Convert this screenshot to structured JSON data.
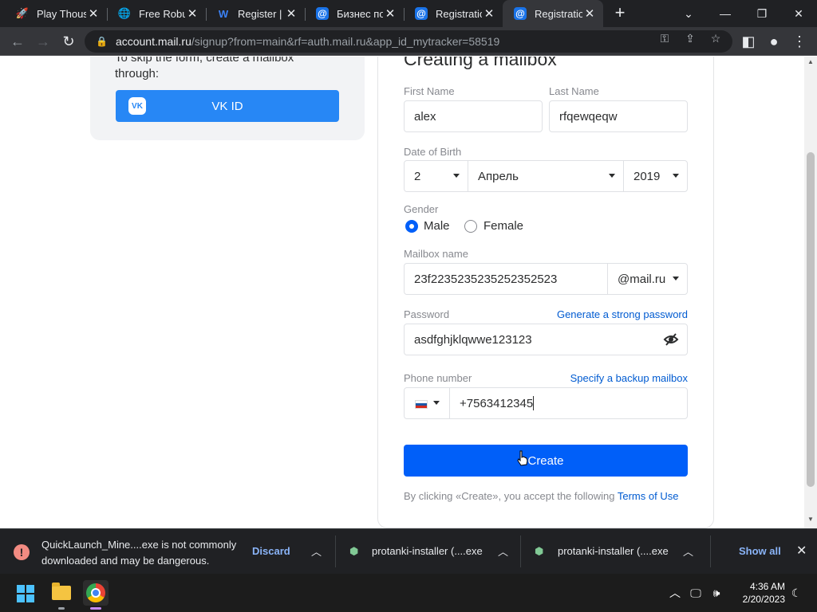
{
  "tabs": [
    {
      "title": "Play Thous",
      "favicon": "rocket-icon"
    },
    {
      "title": "Free Robux",
      "favicon": "globe-icon"
    },
    {
      "title": "Register | V",
      "favicon": "w-logo-icon"
    },
    {
      "title": "Бизнес по",
      "favicon": "mail-at-icon"
    },
    {
      "title": "Registratio",
      "favicon": "mail-at-icon"
    },
    {
      "title": "Registratio",
      "favicon": "mail-at-icon",
      "active": true
    }
  ],
  "address": {
    "host": "account.mail.ru",
    "rest": "/signup?from=main&rf=auth.mail.ru&app_id_mytracker=58519"
  },
  "left": {
    "text": "To skip the form, create a mailbox through:",
    "vk_label": "VK ID",
    "vk_logo": "VK"
  },
  "form": {
    "title": "Creating a mailbox",
    "first_name": {
      "label": "First Name",
      "value": "alex"
    },
    "last_name": {
      "label": "Last Name",
      "value": "rfqewqeqw"
    },
    "dob": {
      "label": "Date of Birth",
      "day": "2",
      "month": "Апрель",
      "year": "2019"
    },
    "gender": {
      "label": "Gender",
      "male": "Male",
      "female": "Female",
      "selected": "Male"
    },
    "mailbox": {
      "label": "Mailbox name",
      "value": "23f2235235235252352523",
      "domain": "@mail.ru"
    },
    "password": {
      "label": "Password",
      "generate_link": "Generate a strong password",
      "value": "asdfghjklqwwe123123"
    },
    "phone": {
      "label": "Phone number",
      "backup_link": "Specify a backup mailbox",
      "value": "+7563412345"
    },
    "create_label": "Create",
    "terms_text": "By clicking «Create», you accept the following",
    "terms_link": "Terms of Use"
  },
  "downloads": {
    "warning_text": "QuickLaunch_Mine....exe is not commonly downloaded and may be dangerous.",
    "discard": "Discard",
    "item1": "protanki-installer (....exe",
    "item2": "protanki-installer (....exe",
    "show_all": "Show all"
  },
  "taskbar": {
    "time": "4:36 AM",
    "date": "2/20/2023"
  },
  "colors": {
    "accent": "#005ff9",
    "vk": "#2787f5",
    "link": "#005bd1"
  }
}
